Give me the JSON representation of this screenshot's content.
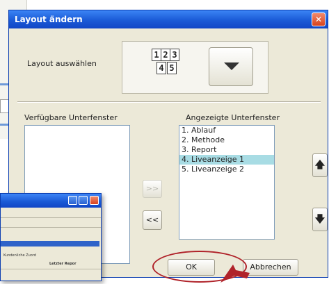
{
  "dialog": {
    "title": "Layout ändern",
    "close_glyph": "✕",
    "layout_label": "Layout auswählen",
    "layout_cells": [
      "1",
      "2",
      "3",
      "4",
      "5"
    ],
    "available_title": "Verfügbare Unterfenster",
    "available_items": [],
    "shown_title": "Angezeigte Unterfenster",
    "shown_items": [
      "1. Ablauf",
      "2. Methode",
      "3. Report",
      "4. Liveanzeige 1",
      "5. Liveanzeige 2"
    ],
    "selected_index": 3,
    "move_right_label": ">>",
    "move_left_label": "<<",
    "up_glyph": "🡅",
    "down_glyph": "🡇",
    "ok_label": "OK",
    "cancel_label": "Abbrechen"
  },
  "secondary_window": {
    "text_row1": "Kundenliche Zuord",
    "text_row2": "Letzter Repor"
  },
  "colors": {
    "title_bar": "#1a5ad6",
    "selection": "#a8dce4",
    "highlight": "#b0232a"
  }
}
